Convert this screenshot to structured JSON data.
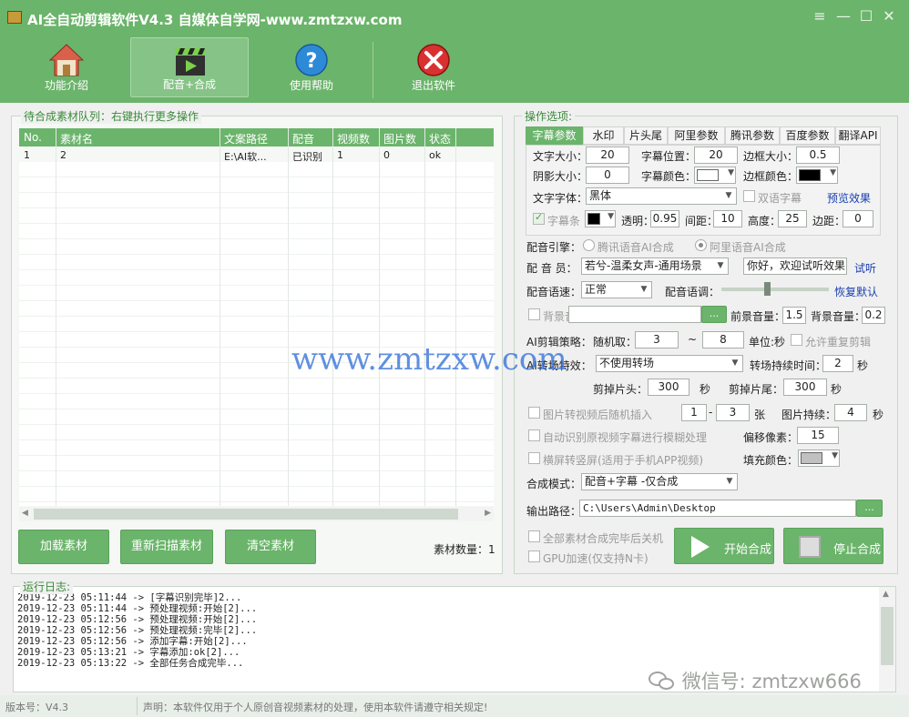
{
  "title": "AI全自动剪辑软件V4.3  自媒体自学网-www.zmtzxw.com",
  "window_controls": {
    "menu": "≡",
    "minimize": "—",
    "maximize": "☐",
    "close": "✕"
  },
  "toolbar": {
    "intro": "功能介绍",
    "dub_compose": "配音+合成",
    "help": "使用帮助",
    "exit": "退出软件"
  },
  "queue": {
    "title": "待合成素材队列：右键执行更多操作",
    "columns": [
      "No.",
      "素材名",
      "文案路径",
      "配音",
      "视频数",
      "图片数",
      "状态"
    ],
    "rows": [
      [
        "1",
        "2",
        "E:\\AI软...",
        "已识别",
        "1",
        "0",
        "ok"
      ]
    ],
    "scroll_left": "◀",
    "scroll_right": "▶"
  },
  "buttons": {
    "load": "加载素材",
    "rescan": "重新扫描素材",
    "clear": "清空素材"
  },
  "material_count": "素材数量：1",
  "options": {
    "title": "操作选项:",
    "tabs": [
      "字幕参数",
      "水印",
      "片头尾",
      "阿里参数",
      "腾讯参数",
      "百度参数",
      "翻译API"
    ],
    "font_size_label": "文字大小：",
    "font_size": "20",
    "sub_pos_label": "字幕位置：",
    "sub_pos": "20",
    "border_size_label": "边框大小：",
    "border_size": "0.5",
    "shadow_label": "阴影大小：",
    "shadow": "0",
    "sub_color_label": "字幕颜色：",
    "border_color_label": "边框颜色：",
    "font_label": "文字字体：",
    "font": "黑体",
    "bilingual": "双语字幕",
    "preview": "预览效果",
    "subbar": "字幕条",
    "opacity_label": "透明：",
    "opacity": "0.95",
    "spacing_label": "间距：",
    "spacing": "10",
    "height_label": "高度：",
    "height": "25",
    "margin_label": "边距：",
    "margin": "0",
    "engine_label": "配音引擎：",
    "engine_tencent": "腾讯语音AI合成",
    "engine_ali": "阿里语音AI合成",
    "voice_label": "配 音 员：",
    "voice": "若兮-温柔女声-通用场景",
    "try_text": "你好，欢迎试听效果",
    "try_link": "试听",
    "speed_label": "配音语速：",
    "speed": "正常",
    "tone_label": "配音语调：",
    "tone_reset": "恢复默认",
    "bgm_label": "背景音",
    "bgm_btn": "...",
    "fg_vol_label": "前景音量：",
    "fg_vol": "1.5",
    "bg_vol_label": "背景音量：",
    "bg_vol": "0.2",
    "ai_cut_label": "AI剪辑策略：",
    "random_label": "随机取：",
    "rand_from": "3",
    "rand_sep": "~",
    "rand_to": "8",
    "unit_label": "单位:秒",
    "allow_repeat": "允许重复剪辑",
    "transition_label": "AI转场特效：",
    "transition": "不使用转场",
    "trans_dur_label": "转场持续时间：",
    "trans_dur": "2",
    "sec": "秒",
    "cut_head_label": "剪掉片头：",
    "cut_head": "300",
    "cut_tail_label": "剪掉片尾：",
    "cut_tail": "300",
    "img_insert_label": "图片转视频后随机插入",
    "img_from": "1",
    "img_sep": "-",
    "img_to": "3",
    "zhang": "张",
    "img_dur_label": "图片持续：",
    "img_dur": "4",
    "blur_label": "自动识别原视频字幕进行模糊处理",
    "offset_label": "偏移像素：",
    "offset": "15",
    "portrait_label": "横屏转竖屏(适用于手机APP视频)",
    "fill_color_label": "填充颜色：",
    "mode_label": "合成模式：",
    "mode": "配音+字幕 -仅合成",
    "output_label": "输出路径：",
    "output": "C:\\Users\\Admin\\Desktop",
    "output_btn": "...",
    "shutdown_label": "全部素材合成完毕后关机",
    "gpu_label": "GPU加速(仅支持N卡)",
    "start": "开始合成",
    "stop": "停止合成"
  },
  "colors": {
    "sub_color": "#ffffff",
    "border_color": "#000000",
    "bar_color": "#000000",
    "fill_color": "#c0c0c0",
    "accent": "#6bb46b"
  },
  "log": {
    "title": "运行日志:",
    "lines": [
      "2019-12-23 05:11:44 -> [字幕识别完毕]2...",
      "2019-12-23 05:11:44 -> 预处理视频:开始[2]...",
      "2019-12-23 05:12:56 -> 预处理视频:开始[2]...",
      "2019-12-23 05:12:56 -> 预处理视频:完毕[2]...",
      "2019-12-23 05:12:56 -> 添加字幕:开始[2]...",
      "2019-12-23 05:13:21 -> 字幕添加:ok[2]...",
      "2019-12-23 05:13:22 -> 全部任务合成完毕..."
    ]
  },
  "status": {
    "version": "版本号：V4.3",
    "notice": "声明：本软件仅用于个人原创音视频素材的处理，使用本软件请遵守相关规定!"
  },
  "watermark": "www.zmtzxw.com",
  "wechat": "微信号: zmtzxw666"
}
